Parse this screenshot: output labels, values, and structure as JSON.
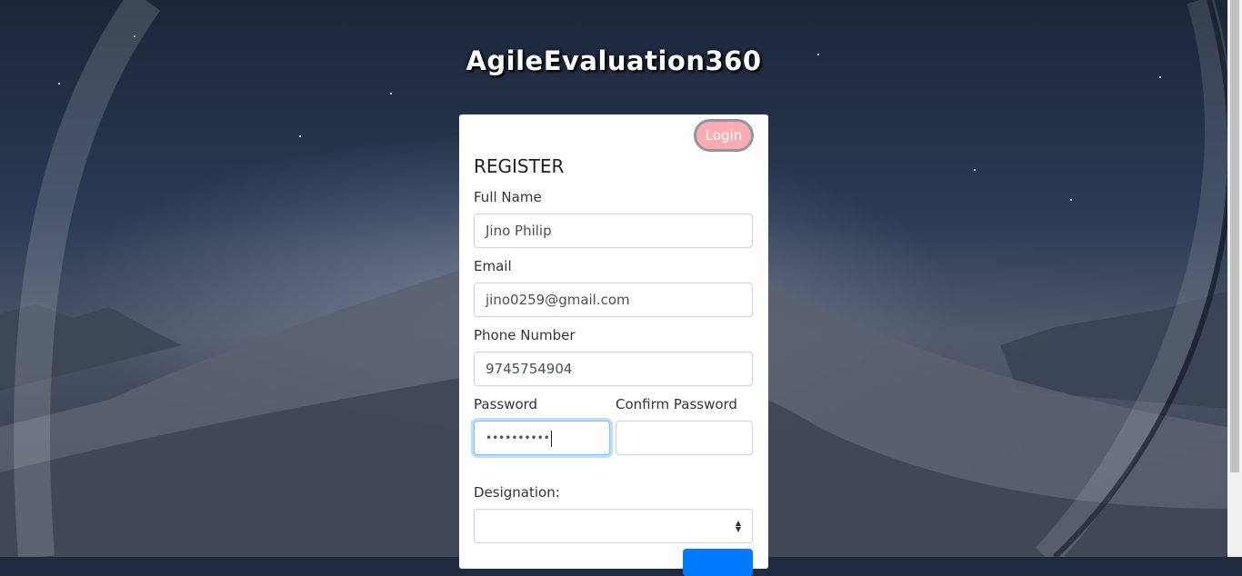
{
  "app": {
    "title": "AgileEvaluation360"
  },
  "card": {
    "login_label": "Login",
    "heading": "REGISTER",
    "full_name": {
      "label": "Full Name",
      "value": "Jino Philip"
    },
    "email": {
      "label": "Email",
      "value": "jino0259@gmail.com"
    },
    "phone": {
      "label": "Phone Number",
      "value": "9745754904"
    },
    "password": {
      "label": "Password",
      "value": "••••••••••"
    },
    "confirm_password": {
      "label": "Confirm Password",
      "value": ""
    },
    "designation": {
      "label": "Designation:",
      "value": ""
    }
  },
  "colors": {
    "login_button": "#ffabb1",
    "primary": "#007bff",
    "focus": "#80bdff"
  },
  "icons": {
    "select_arrows": "select-arrows-icon"
  }
}
